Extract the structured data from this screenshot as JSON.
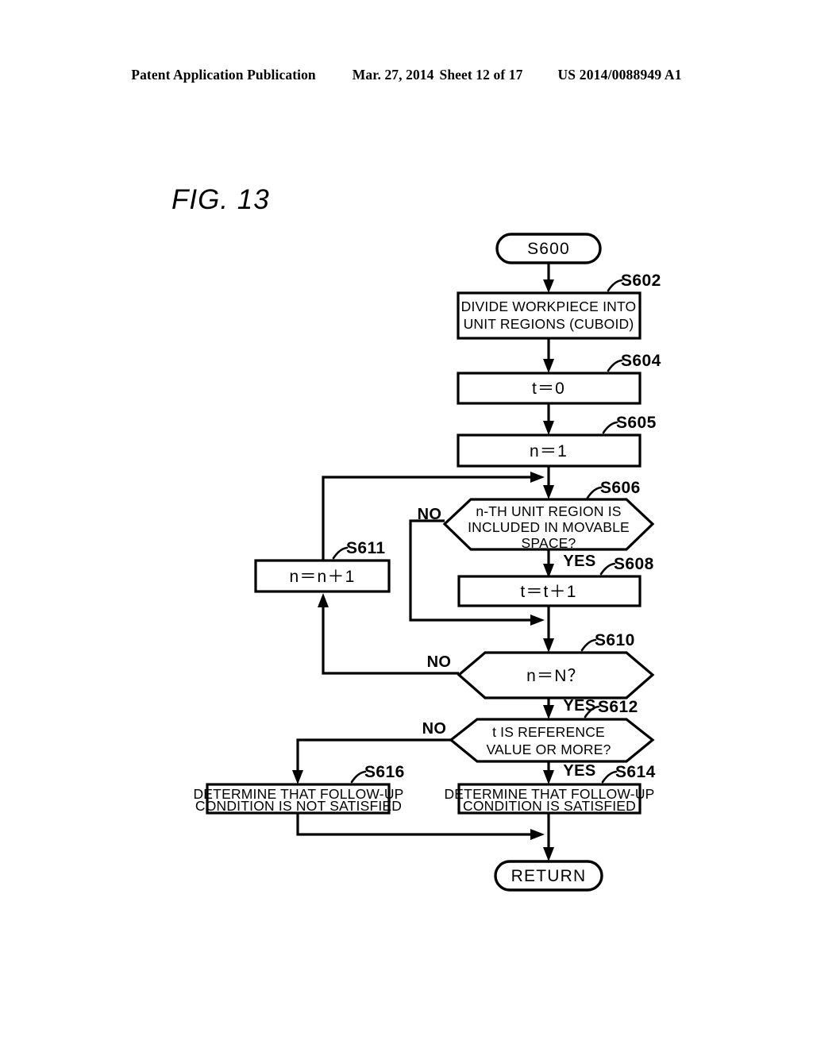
{
  "header": {
    "publication": "Patent Application Publication",
    "date": "Mar. 27, 2014",
    "sheet": "Sheet 12 of 17",
    "patent_number": "US 2014/0088949 A1"
  },
  "figure": {
    "label": "FIG. 13"
  },
  "chart_data": {
    "type": "diagram",
    "diagram_kind": "flowchart",
    "title": "FIG. 13",
    "nodes": [
      {
        "id": "S600",
        "step": "S600",
        "shape": "terminal",
        "lines": [
          "S600"
        ]
      },
      {
        "id": "S602",
        "step": "S602",
        "shape": "process",
        "lines": [
          "DIVIDE WORKPIECE INTO",
          "UNIT REGIONS (CUBOID)"
        ]
      },
      {
        "id": "S604",
        "step": "S604",
        "shape": "process",
        "lines": [
          "t＝0"
        ]
      },
      {
        "id": "S605",
        "step": "S605",
        "shape": "process",
        "lines": [
          "n＝1"
        ]
      },
      {
        "id": "S606",
        "step": "S606",
        "shape": "decision",
        "lines": [
          "n-TH UNIT REGION IS",
          "INCLUDED IN MOVABLE",
          "SPACE?"
        ]
      },
      {
        "id": "S608",
        "step": "S608",
        "shape": "process",
        "lines": [
          "t＝t＋1"
        ]
      },
      {
        "id": "S611",
        "step": "S611",
        "shape": "process",
        "lines": [
          "n＝n＋1"
        ]
      },
      {
        "id": "S610",
        "step": "S610",
        "shape": "decision",
        "lines": [
          "n＝N？"
        ]
      },
      {
        "id": "S612",
        "step": "S612",
        "shape": "decision",
        "lines": [
          "t IS REFERENCE",
          "VALUE OR MORE?"
        ]
      },
      {
        "id": "S614",
        "step": "S614",
        "shape": "process",
        "lines": [
          "DETERMINE THAT FOLLOW-UP",
          "CONDITION IS SATISFIED"
        ]
      },
      {
        "id": "S616",
        "step": "S616",
        "shape": "process",
        "lines": [
          "DETERMINE THAT FOLLOW-UP",
          "CONDITION IS NOT SATISFIED"
        ]
      },
      {
        "id": "RETURN",
        "step": "",
        "shape": "terminal",
        "lines": [
          "RETURN"
        ]
      }
    ],
    "edges": [
      {
        "from": "S600",
        "to": "S602",
        "label": ""
      },
      {
        "from": "S602",
        "to": "S604",
        "label": ""
      },
      {
        "from": "S604",
        "to": "S605",
        "label": ""
      },
      {
        "from": "S605",
        "to": "S606",
        "label": ""
      },
      {
        "from": "S606",
        "to": "S608",
        "label": "YES"
      },
      {
        "from": "S606",
        "to": "S610",
        "label": "NO"
      },
      {
        "from": "S608",
        "to": "S610",
        "label": ""
      },
      {
        "from": "S610",
        "to": "S611",
        "label": "NO"
      },
      {
        "from": "S611",
        "to": "S606",
        "label": ""
      },
      {
        "from": "S610",
        "to": "S612",
        "label": "YES"
      },
      {
        "from": "S612",
        "to": "S614",
        "label": "YES"
      },
      {
        "from": "S612",
        "to": "S616",
        "label": "NO"
      },
      {
        "from": "S614",
        "to": "RETURN",
        "label": ""
      },
      {
        "from": "S616",
        "to": "RETURN",
        "label": ""
      }
    ],
    "branch_labels": {
      "s606_no": "NO",
      "s606_yes": "YES",
      "s610_no": "NO",
      "s610_yes": "YES",
      "s612_no": "NO",
      "s612_yes": "YES"
    },
    "step_labels": {
      "s600": "S600",
      "s602": "S602",
      "s604": "S604",
      "s605": "S605",
      "s606": "S606",
      "s608": "S608",
      "s610": "S610",
      "s611": "S611",
      "s612": "S612",
      "s614": "S614",
      "s616": "S616"
    },
    "node_text": {
      "s600": "S600",
      "s602_l1": "DIVIDE WORKPIECE INTO",
      "s602_l2": "UNIT REGIONS (CUBOID)",
      "s604": "t＝0",
      "s605": "n＝1",
      "s606_l1": "n-TH UNIT REGION IS",
      "s606_l2": "INCLUDED IN MOVABLE",
      "s606_l3": "SPACE?",
      "s608": "t＝t＋1",
      "s611": "n＝n＋1",
      "s610": "n＝N？",
      "s612_l1": "t IS REFERENCE",
      "s612_l2": "VALUE OR MORE?",
      "s614_l1": "DETERMINE THAT FOLLOW-UP",
      "s614_l2": "CONDITION IS SATISFIED",
      "s616_l1": "DETERMINE THAT FOLLOW-UP",
      "s616_l2": "CONDITION IS NOT SATISFIED",
      "return": "RETURN"
    },
    "colors": {
      "ink": "#000000",
      "paper": "#ffffff"
    }
  }
}
